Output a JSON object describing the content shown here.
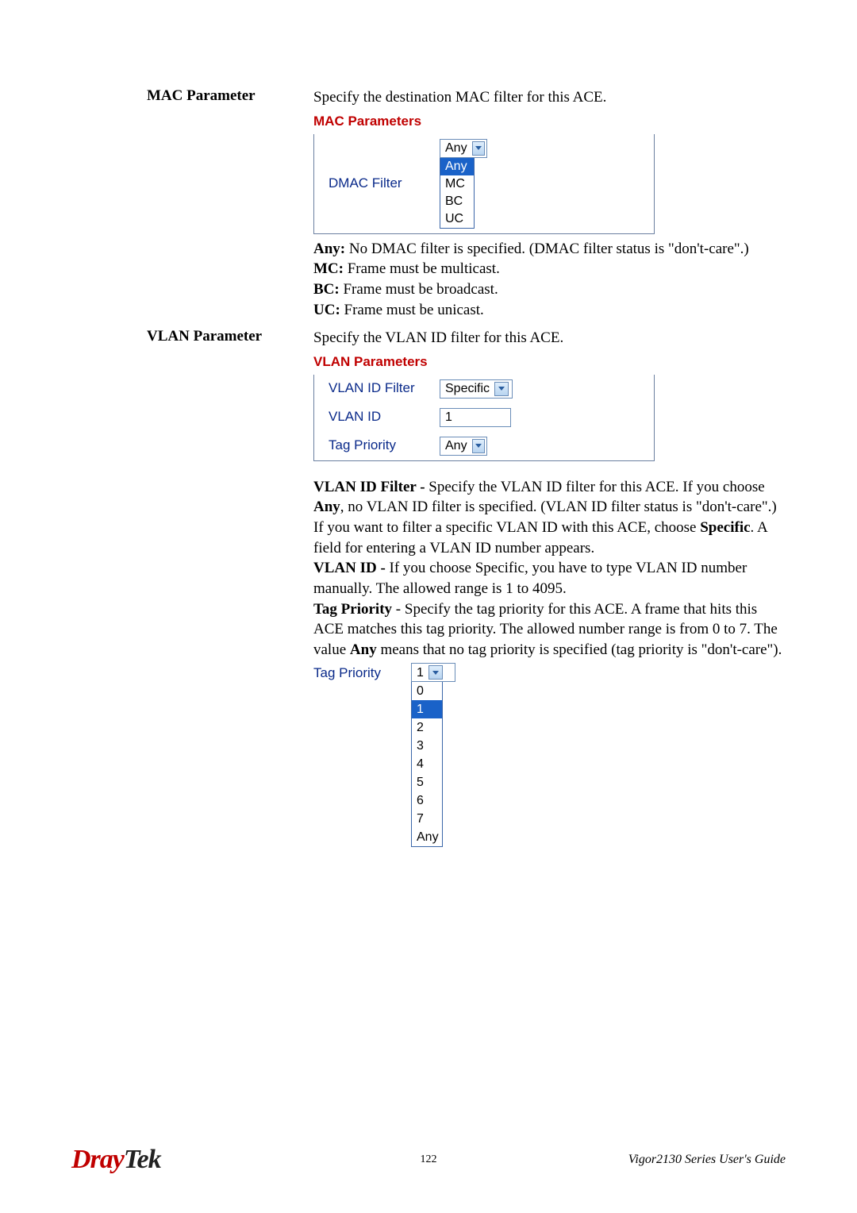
{
  "mac": {
    "heading": "MAC Parameter",
    "intro": "Specify the destination MAC filter for this ACE.",
    "section_title": "MAC Parameters",
    "field_label": "DMAC Filter",
    "selected": "Any",
    "options": [
      "Any",
      "MC",
      "BC",
      "UC"
    ],
    "desc": {
      "any_label": "Any:",
      "any_text": " No DMAC filter is specified. (DMAC filter status is \"don't-care\".)",
      "mc_label": "MC:",
      "mc_text": " Frame must be multicast.",
      "bc_label": "BC:",
      "bc_text": " Frame must be broadcast.",
      "uc_label": "UC:",
      "uc_text": " Frame must be unicast."
    }
  },
  "vlan": {
    "heading": "VLAN Parameter",
    "intro": "Specify the VLAN ID filter for this ACE.",
    "section_title": "VLAN Parameters",
    "fields": {
      "idfilter_label": "VLAN ID Filter",
      "idfilter_value": "Specific",
      "id_label": "VLAN ID",
      "id_value": "1",
      "tag_label": "Tag Priority",
      "tag_value": "Any"
    },
    "desc": {
      "idfilter_label": "VLAN ID Filter - ",
      "idfilter_text_a": "Specify the VLAN ID filter for this ACE. If you choose ",
      "idfilter_any": "Any",
      "idfilter_text_b": ", no VLAN ID filter is specified. (VLAN ID filter status is \"don't-care\".) If you want to filter a specific VLAN ID with this ACE, choose ",
      "idfilter_specific": "Specific",
      "idfilter_text_c": ". A field for entering a VLAN ID number appears.",
      "id_label": "VLAN ID - ",
      "id_text_a": "If you choose Specific, you have to type VLAN ID number manually. The allowed range is ",
      "id_range_a": "1",
      "id_range_mid": " to ",
      "id_range_b": "4095",
      "id_text_b": ".",
      "tag_label": "Tag Priority",
      "tag_text_a": " - Specify the tag priority for this ACE. A frame that hits this ACE matches this tag priority. The allowed number range is from 0 to 7. The value ",
      "tag_any": "Any",
      "tag_text_b": " means that no tag priority is specified (tag priority is \"don't-care\")."
    },
    "tag_dropdown": {
      "label": "Tag Priority",
      "selected": "1",
      "options": [
        "0",
        "1",
        "2",
        "3",
        "4",
        "5",
        "6",
        "7",
        "Any"
      ]
    }
  },
  "footer": {
    "logo_a": "Dray",
    "logo_b": "Tek",
    "page_number": "122",
    "guide": "Vigor2130 Series User's Guide"
  }
}
